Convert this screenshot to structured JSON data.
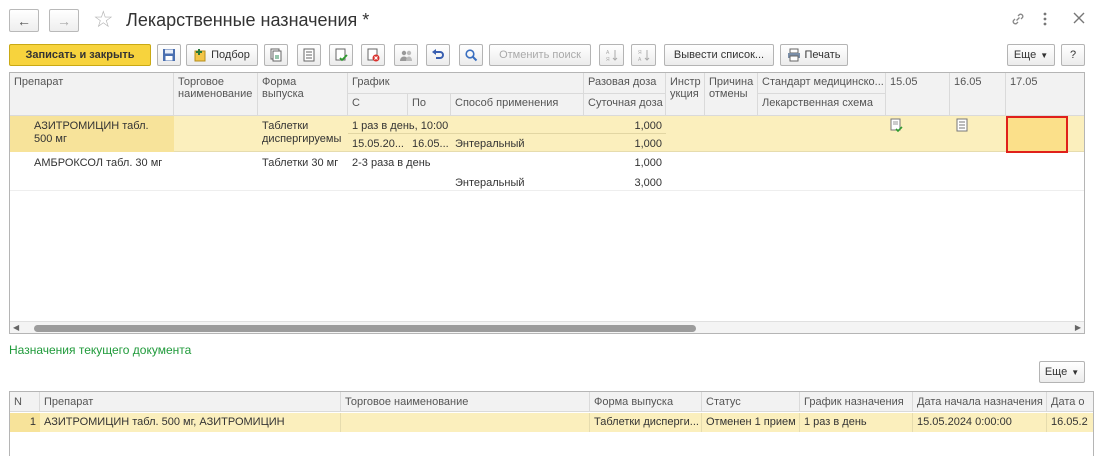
{
  "window": {
    "title": "Лекарственные назначения *"
  },
  "toolbar": {
    "save_close_label": "Записать и закрыть",
    "podbor_label": "Подбор",
    "cancel_search_label": "Отменить поиск",
    "output_list_label": "Вывести список...",
    "print_label": "Печать",
    "more_label": "Еще",
    "help_label": "?"
  },
  "main_table": {
    "headers": {
      "drug": "Препарат",
      "trade_name_1": "Торговое",
      "trade_name_2": "наименование",
      "form_1": "Форма",
      "form_2": "выпуска",
      "schedule": "График",
      "from": "С",
      "to": "По",
      "method": "Способ применения",
      "single_dose": "Разовая доза",
      "daily_dose": "Суточная доза",
      "instr_1": "Инстр",
      "instr_2": "укция",
      "reason_1": "Причина",
      "reason_2": "отмены",
      "standard": "Стандарт медицинско...",
      "scheme": "Лекарственная схема",
      "d1": "15.05",
      "d2": "16.05",
      "d3": "17.05"
    },
    "rows": [
      {
        "drug_1": "АЗИТРОМИЦИН табл.",
        "drug_2": "500 мг",
        "form_1": "Таблетки",
        "form_2": "диспергируемы",
        "schedule": "1 раз в день, 10:00",
        "from": "15.05.20...",
        "to": "16.05...",
        "method": "Энтеральный",
        "single_dose": "1,000",
        "daily_dose": "1,000"
      },
      {
        "drug_1": "АМБРОКСОЛ табл. 30 мг",
        "form_1": "Таблетки 30 мг",
        "schedule": "2-3 раза в день",
        "method": "Энтеральный",
        "single_dose": "1,000",
        "daily_dose": "3,000"
      }
    ]
  },
  "section_title": "Назначения текущего документа",
  "bottom_more_label": "Еще",
  "bottom_table": {
    "headers": [
      "N",
      "Препарат",
      "Торговое наименование",
      "Форма выпуска",
      "Статус",
      "График назначения",
      "Дата начала назначения",
      "Дата о"
    ],
    "row": {
      "n": "1",
      "drug": "АЗИТРОМИЦИН табл. 500 мг, АЗИТРОМИЦИН",
      "trade": "",
      "form": "Таблетки дисперги...",
      "status": "Отменен 1 прием",
      "schedule": "1 раз в день",
      "start": "15.05.2024 0:00:00",
      "end": "16.05.2"
    }
  },
  "colors": {
    "selected_row": "#fbefbd",
    "primary_button": "#f7d33d",
    "section_title": "#1f9a3a",
    "highlight_border": "#e0201a"
  }
}
